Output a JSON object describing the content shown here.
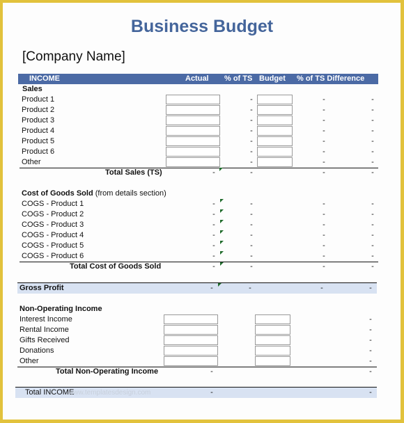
{
  "document": {
    "title": "Business Budget",
    "company_name": "[Company Name]"
  },
  "header": {
    "section": "INCOME",
    "columns": [
      "Actual",
      "% of TS",
      "Budget",
      "% of TS Difference"
    ]
  },
  "sales": {
    "heading": "Sales",
    "items": [
      "Product 1",
      "Product 2",
      "Product 3",
      "Product 4",
      "Product 5",
      "Product 6",
      "Other"
    ],
    "actual_values": [
      "",
      "",
      "",
      "",
      "",
      "",
      ""
    ],
    "budget_values": [
      "",
      "",
      "",
      "",
      "",
      "",
      ""
    ],
    "pct_ts": "-",
    "pct_ts_budget": "-",
    "difference": "-",
    "total_label": "Total Sales (TS)",
    "total_value": "-"
  },
  "cogs": {
    "heading": "Cost of Goods Sold",
    "heading_note": "(from details section)",
    "items": [
      "COGS - Product 1",
      "COGS - Product 2",
      "COGS - Product 3",
      "COGS - Product 4",
      "COGS - Product 5",
      "COGS - Product 6"
    ],
    "value": "-",
    "total_label": "Total Cost of Goods Sold",
    "total_value": "-"
  },
  "gross_profit": {
    "label": "Gross Profit",
    "value": "-"
  },
  "non_operating": {
    "heading": "Non-Operating Income",
    "items": [
      "Interest Income",
      "Rental Income",
      "Gifts Received",
      "Donations",
      "Other"
    ],
    "actual_values": [
      "",
      "",
      "",
      "",
      ""
    ],
    "budget_values": [
      "",
      "",
      "",
      "",
      ""
    ],
    "difference": "-",
    "total_label": "Total Non-Operating Income",
    "total_value": "-"
  },
  "total_income": {
    "label": "Total INCOME",
    "value": "-",
    "watermark": "www.templatesdesign.com"
  },
  "colors": {
    "frame": "#e2c23c",
    "header_bar": "#4b6aa5",
    "title": "#44659b",
    "band": "#d8e2f2",
    "comment_marker": "#1f6b2b"
  }
}
